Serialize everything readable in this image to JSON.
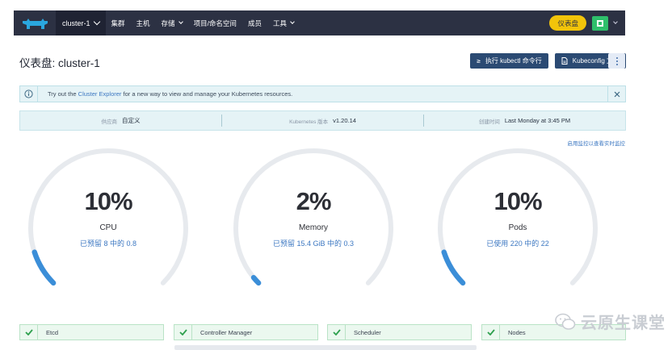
{
  "nav": {
    "cluster_name": "cluster-1",
    "items": [
      "集群",
      "主机",
      "存储",
      "项目/命名空间",
      "成员",
      "工具"
    ],
    "dashboard_button": "仪表盘"
  },
  "page": {
    "title": "仪表盘: cluster-1",
    "kubectl_button": "执行 kubectl 命令行",
    "kubectl_glyph": "≥",
    "kubeconfig_button": "Kubeconfig 文件"
  },
  "banner": {
    "text_before": "Try out the ",
    "link": "Cluster Explorer",
    "text_after": " for a new way to view and manage your Kubernetes resources."
  },
  "info": {
    "provider_label": "供应商",
    "provider_value": "自定义",
    "k8s_label": "Kubernetes 版本",
    "k8s_value": "v1.20.14",
    "created_label": "创建时间",
    "created_value": "Last Monday at 3:45 PM"
  },
  "monitor_link": "启用监控以查看实时监控",
  "gauges": [
    {
      "percent": "10%",
      "name": "CPU",
      "sub": "已预留 8 中的 0.8",
      "value": 0.1
    },
    {
      "percent": "2%",
      "name": "Memory",
      "sub": "已预留 15.4 GiB 中的 0.3",
      "value": 0.02
    },
    {
      "percent": "10%",
      "name": "Pods",
      "sub": "已使用 220 中的 22",
      "value": 0.1
    }
  ],
  "components": [
    "Etcd",
    "Controller Manager",
    "Scheduler",
    "Nodes"
  ],
  "watermark": "云原生课堂",
  "colors": {
    "nav_bg": "#2c3143",
    "accent_yellow": "#f2c40a",
    "gauge_fill": "#3b8ed8",
    "gauge_track": "#e7eaee",
    "healthy_green": "#2ea04e"
  }
}
